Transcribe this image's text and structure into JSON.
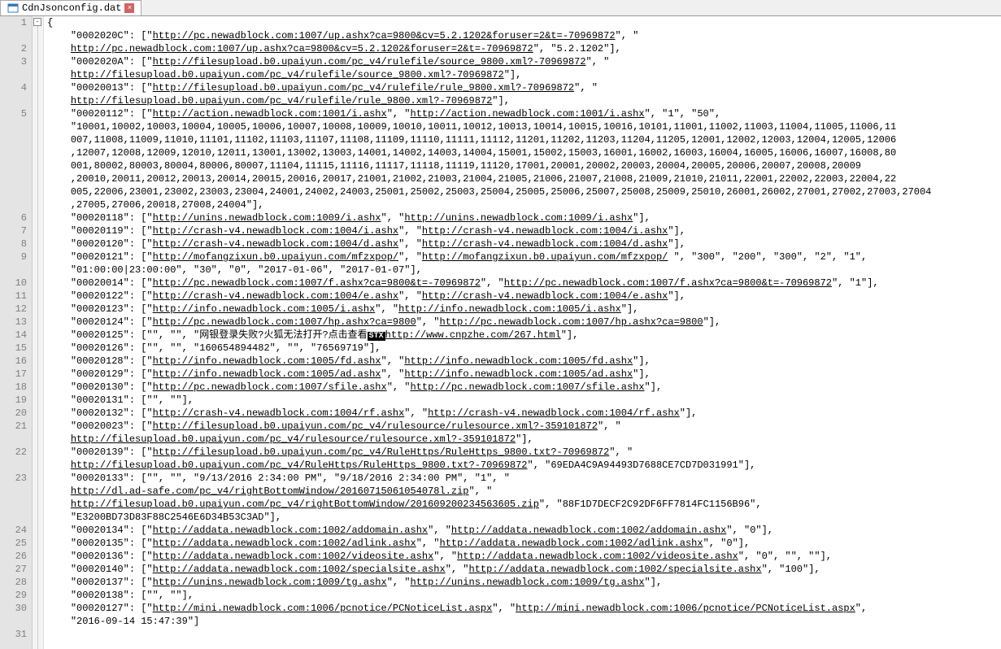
{
  "tab": {
    "filename": "CdnJsonconfig.dat",
    "close": "×"
  },
  "fold": "-",
  "lines": [
    {
      "n": 1,
      "ind": 0,
      "segs": [
        {
          "t": "txt",
          "v": "{"
        }
      ]
    },
    {
      "n": 0,
      "ind": 1,
      "segs": [
        {
          "t": "txt",
          "v": "\"0002020C\": [\""
        },
        {
          "t": "url",
          "v": "http://pc.newadblock.com:1007/up.ashx?ca=9800&cv=5.2.1202&foruser=2&t=-70969872"
        },
        {
          "t": "txt",
          "v": "\", \""
        }
      ]
    },
    {
      "n": 2,
      "ind": 1,
      "segs": [
        {
          "t": "url",
          "v": "http://pc.newadblock.com:1007/up.ashx?ca=9800&cv=5.2.1202&foruser=2&t=-70969872"
        },
        {
          "t": "txt",
          "v": "\", \"5.2.1202\"],"
        }
      ]
    },
    {
      "n": 3,
      "ind": 1,
      "segs": [
        {
          "t": "txt",
          "v": "\"0002020A\": [\""
        },
        {
          "t": "url",
          "v": "http://filesupload.b0.upaiyun.com/pc_v4/rulefile/source_9800.xml?-70969872"
        },
        {
          "t": "txt",
          "v": "\", \""
        }
      ]
    },
    {
      "n": 0,
      "ind": 1,
      "segs": [
        {
          "t": "url",
          "v": "http://filesupload.b0.upaiyun.com/pc_v4/rulefile/source_9800.xml?-70969872"
        },
        {
          "t": "txt",
          "v": "\"],"
        }
      ]
    },
    {
      "n": 4,
      "ind": 1,
      "segs": [
        {
          "t": "txt",
          "v": "\"00020013\": [\""
        },
        {
          "t": "url",
          "v": "http://filesupload.b0.upaiyun.com/pc_v4/rulefile/rule_9800.xml?-70969872"
        },
        {
          "t": "txt",
          "v": "\", \""
        }
      ]
    },
    {
      "n": 0,
      "ind": 1,
      "segs": [
        {
          "t": "url",
          "v": "http://filesupload.b0.upaiyun.com/pc_v4/rulefile/rule_9800.xml?-70969872"
        },
        {
          "t": "txt",
          "v": "\"],"
        }
      ]
    },
    {
      "n": 5,
      "ind": 1,
      "segs": [
        {
          "t": "txt",
          "v": "\"00020112\": [\""
        },
        {
          "t": "url",
          "v": "http://action.newadblock.com:1001/i.ashx"
        },
        {
          "t": "txt",
          "v": "\", \""
        },
        {
          "t": "url",
          "v": "http://action.newadblock.com:1001/i.ashx"
        },
        {
          "t": "txt",
          "v": "\", \"1\", \"50\","
        }
      ]
    },
    {
      "n": 0,
      "ind": 1,
      "segs": [
        {
          "t": "txt",
          "v": "\"10001,10002,10003,10004,10005,10006,10007,10008,10009,10010,10011,10012,10013,10014,10015,10016,10101,11001,11002,11003,11004,11005,11006,11"
        }
      ]
    },
    {
      "n": 0,
      "ind": 1,
      "segs": [
        {
          "t": "txt",
          "v": "007,11008,11009,11010,11101,11102,11103,11107,11108,11109,11110,11111,11112,11201,11202,11203,11204,11205,12001,12002,12003,12004,12005,12006"
        }
      ]
    },
    {
      "n": 0,
      "ind": 1,
      "segs": [
        {
          "t": "txt",
          "v": ",12007,12008,12009,12010,12011,13001,13002,13003,14001,14002,14003,14004,15001,15002,15003,16001,16002,16003,16004,16005,16006,16007,16008,80"
        }
      ]
    },
    {
      "n": 0,
      "ind": 1,
      "segs": [
        {
          "t": "txt",
          "v": "001,80002,80003,80004,80006,80007,11104,11115,11116,11117,11118,11119,11120,17001,20001,20002,20003,20004,20005,20006,20007,20008,20009"
        }
      ]
    },
    {
      "n": 0,
      "ind": 1,
      "segs": [
        {
          "t": "txt",
          "v": ",20010,20011,20012,20013,20014,20015,20016,20017,21001,21002,21003,21004,21005,21006,21007,21008,21009,21010,21011,22001,22002,22003,22004,22"
        }
      ]
    },
    {
      "n": 0,
      "ind": 1,
      "segs": [
        {
          "t": "txt",
          "v": "005,22006,23001,23002,23003,23004,24001,24002,24003,25001,25002,25003,25004,25005,25006,25007,25008,25009,25010,26001,26002,27001,27002,27003,27004"
        }
      ]
    },
    {
      "n": 0,
      "ind": 1,
      "segs": [
        {
          "t": "txt",
          "v": ",27005,27006,20018,27008,24004\"],"
        }
      ]
    },
    {
      "n": 6,
      "ind": 1,
      "segs": [
        {
          "t": "txt",
          "v": "\"00020118\": [\""
        },
        {
          "t": "url",
          "v": "http://unins.newadblock.com:1009/i.ashx"
        },
        {
          "t": "txt",
          "v": "\", \""
        },
        {
          "t": "url",
          "v": "http://unins.newadblock.com:1009/i.ashx"
        },
        {
          "t": "txt",
          "v": "\"],"
        }
      ]
    },
    {
      "n": 7,
      "ind": 1,
      "segs": [
        {
          "t": "txt",
          "v": "\"00020119\": [\""
        },
        {
          "t": "url",
          "v": "http://crash-v4.newadblock.com:1004/i.ashx"
        },
        {
          "t": "txt",
          "v": "\", \""
        },
        {
          "t": "url",
          "v": "http://crash-v4.newadblock.com:1004/i.ashx"
        },
        {
          "t": "txt",
          "v": "\"],"
        }
      ]
    },
    {
      "n": 8,
      "ind": 1,
      "segs": [
        {
          "t": "txt",
          "v": "\"00020120\": [\""
        },
        {
          "t": "url",
          "v": "http://crash-v4.newadblock.com:1004/d.ashx"
        },
        {
          "t": "txt",
          "v": "\", \""
        },
        {
          "t": "url",
          "v": "http://crash-v4.newadblock.com:1004/d.ashx"
        },
        {
          "t": "txt",
          "v": "\"],"
        }
      ]
    },
    {
      "n": 9,
      "ind": 1,
      "segs": [
        {
          "t": "txt",
          "v": "\"00020121\": [\""
        },
        {
          "t": "url",
          "v": "http://mofangzixun.b0.upaiyun.com/mfzxpop/"
        },
        {
          "t": "txt",
          "v": "\", \""
        },
        {
          "t": "url",
          "v": "http://mofangzixun.b0.upaiyun.com/mfzxpop/"
        },
        {
          "t": "txt",
          "v": " \", \"300\", \"200\", \"300\", \"2\", \"1\","
        }
      ]
    },
    {
      "n": 0,
      "ind": 1,
      "segs": [
        {
          "t": "txt",
          "v": "\"01:00:00|23:00:00\", \"30\", \"0\", \"2017-01-06\", \"2017-01-07\"],"
        }
      ]
    },
    {
      "n": 10,
      "ind": 1,
      "segs": [
        {
          "t": "txt",
          "v": "\"00020014\": [\""
        },
        {
          "t": "url",
          "v": "http://pc.newadblock.com:1007/f.ashx?ca=9800&t=-70969872"
        },
        {
          "t": "txt",
          "v": "\", \""
        },
        {
          "t": "url",
          "v": "http://pc.newadblock.com:1007/f.ashx?ca=9800&t=-70969872"
        },
        {
          "t": "txt",
          "v": "\", \"1\"],"
        }
      ]
    },
    {
      "n": 11,
      "ind": 1,
      "segs": [
        {
          "t": "txt",
          "v": "\"00020122\": [\""
        },
        {
          "t": "url",
          "v": "http://crash-v4.newadblock.com:1004/e.ashx"
        },
        {
          "t": "txt",
          "v": "\", \""
        },
        {
          "t": "url",
          "v": "http://crash-v4.newadblock.com:1004/e.ashx"
        },
        {
          "t": "txt",
          "v": "\"],"
        }
      ]
    },
    {
      "n": 12,
      "ind": 1,
      "segs": [
        {
          "t": "txt",
          "v": "\"00020123\": [\""
        },
        {
          "t": "url",
          "v": "http://info.newadblock.com:1005/i.ashx"
        },
        {
          "t": "txt",
          "v": "\", \""
        },
        {
          "t": "url",
          "v": "http://info.newadblock.com:1005/i.ashx"
        },
        {
          "t": "txt",
          "v": "\"],"
        }
      ]
    },
    {
      "n": 13,
      "ind": 1,
      "segs": [
        {
          "t": "txt",
          "v": "\"00020124\": [\""
        },
        {
          "t": "url",
          "v": "http://pc.newadblock.com:1007/hp.ashx?ca=9800"
        },
        {
          "t": "txt",
          "v": "\", \""
        },
        {
          "t": "url",
          "v": "http://pc.newadblock.com:1007/hp.ashx?ca=9800"
        },
        {
          "t": "txt",
          "v": "\"],"
        }
      ]
    },
    {
      "n": 14,
      "ind": 1,
      "segs": [
        {
          "t": "txt",
          "v": "\"00020125\": [\"\", \"\", \"网银登录失败?火狐无法打开?点击查看"
        },
        {
          "t": "stx",
          "v": "STX"
        },
        {
          "t": "url",
          "v": "http://www.cnpzhe.com/267.html"
        },
        {
          "t": "txt",
          "v": "\"],"
        }
      ]
    },
    {
      "n": 15,
      "ind": 1,
      "segs": [
        {
          "t": "txt",
          "v": "\"00020126\": [\"\", \"\", \"160654894482\", \"\", \"76569719\"],"
        }
      ]
    },
    {
      "n": 16,
      "ind": 1,
      "segs": [
        {
          "t": "txt",
          "v": "\"00020128\": [\""
        },
        {
          "t": "url",
          "v": "http://info.newadblock.com:1005/fd.ashx"
        },
        {
          "t": "txt",
          "v": "\", \""
        },
        {
          "t": "url",
          "v": "http://info.newadblock.com:1005/fd.ashx"
        },
        {
          "t": "txt",
          "v": "\"],"
        }
      ]
    },
    {
      "n": 17,
      "ind": 1,
      "segs": [
        {
          "t": "txt",
          "v": "\"00020129\": [\""
        },
        {
          "t": "url",
          "v": "http://info.newadblock.com:1005/ad.ashx"
        },
        {
          "t": "txt",
          "v": "\", \""
        },
        {
          "t": "url",
          "v": "http://info.newadblock.com:1005/ad.ashx"
        },
        {
          "t": "txt",
          "v": "\"],"
        }
      ]
    },
    {
      "n": 18,
      "ind": 1,
      "segs": [
        {
          "t": "txt",
          "v": "\"00020130\": [\""
        },
        {
          "t": "url",
          "v": "http://pc.newadblock.com:1007/sfile.ashx"
        },
        {
          "t": "txt",
          "v": "\", \""
        },
        {
          "t": "url",
          "v": "http://pc.newadblock.com:1007/sfile.ashx"
        },
        {
          "t": "txt",
          "v": "\"],"
        }
      ]
    },
    {
      "n": 19,
      "ind": 1,
      "segs": [
        {
          "t": "txt",
          "v": "\"00020131\": [\"\", \"\"],"
        }
      ]
    },
    {
      "n": 20,
      "ind": 1,
      "segs": [
        {
          "t": "txt",
          "v": "\"00020132\": [\""
        },
        {
          "t": "url",
          "v": "http://crash-v4.newadblock.com:1004/rf.ashx"
        },
        {
          "t": "txt",
          "v": "\", \""
        },
        {
          "t": "url",
          "v": "http://crash-v4.newadblock.com:1004/rf.ashx"
        },
        {
          "t": "txt",
          "v": "\"],"
        }
      ]
    },
    {
      "n": 21,
      "ind": 1,
      "segs": [
        {
          "t": "txt",
          "v": "\"00020023\": [\""
        },
        {
          "t": "url",
          "v": "http://filesupload.b0.upaiyun.com/pc_v4/rulesource/rulesource.xml?-359101872"
        },
        {
          "t": "txt",
          "v": "\", \""
        }
      ]
    },
    {
      "n": 0,
      "ind": 1,
      "segs": [
        {
          "t": "url",
          "v": "http://filesupload.b0.upaiyun.com/pc_v4/rulesource/rulesource.xml?-359101872"
        },
        {
          "t": "txt",
          "v": "\"],"
        }
      ]
    },
    {
      "n": 22,
      "ind": 1,
      "segs": [
        {
          "t": "txt",
          "v": "\"00020139\": [\""
        },
        {
          "t": "url",
          "v": "http://filesupload.b0.upaiyun.com/pc_v4/RuleHttps/RuleHttps_9800.txt?-70969872"
        },
        {
          "t": "txt",
          "v": "\", \""
        }
      ]
    },
    {
      "n": 0,
      "ind": 1,
      "segs": [
        {
          "t": "url",
          "v": "http://filesupload.b0.upaiyun.com/pc_v4/RuleHttps/RuleHttps_9800.txt?-70969872"
        },
        {
          "t": "txt",
          "v": "\", \"69EDA4C9A94493D7688CE7CD7D031991\"],"
        }
      ]
    },
    {
      "n": 23,
      "ind": 1,
      "segs": [
        {
          "t": "txt",
          "v": "\"00020133\": [\"\", \"\", \"9/13/2016 2:34:00 PM\", \"9/18/2016 2:34:00 PM\", \"1\", \""
        }
      ]
    },
    {
      "n": 0,
      "ind": 1,
      "segs": [
        {
          "t": "url",
          "v": "http://dl.ad-safe.com/pc_v4/rightBottomWindow/20160715061054078l.zip"
        },
        {
          "t": "txt",
          "v": "\", \""
        }
      ]
    },
    {
      "n": 0,
      "ind": 1,
      "segs": [
        {
          "t": "url",
          "v": "http://filesupload.b0.upaiyun.com/pc_v4/rightBottomWindow/201609200234563605.zip"
        },
        {
          "t": "txt",
          "v": "\", \"88F1D7DECF2C92DF6FF7814FC1156B96\","
        }
      ]
    },
    {
      "n": 0,
      "ind": 1,
      "segs": [
        {
          "t": "txt",
          "v": "\"E3200BD73D83F88C2546E6D34B53C3AD\"],"
        }
      ]
    },
    {
      "n": 24,
      "ind": 1,
      "segs": [
        {
          "t": "txt",
          "v": "\"00020134\": [\""
        },
        {
          "t": "url",
          "v": "http://addata.newadblock.com:1002/addomain.ashx"
        },
        {
          "t": "txt",
          "v": "\", \""
        },
        {
          "t": "url",
          "v": "http://addata.newadblock.com:1002/addomain.ashx"
        },
        {
          "t": "txt",
          "v": "\", \"0\"],"
        }
      ]
    },
    {
      "n": 25,
      "ind": 1,
      "segs": [
        {
          "t": "txt",
          "v": "\"00020135\": [\""
        },
        {
          "t": "url",
          "v": "http://addata.newadblock.com:1002/adlink.ashx"
        },
        {
          "t": "txt",
          "v": "\", \""
        },
        {
          "t": "url",
          "v": "http://addata.newadblock.com:1002/adlink.ashx"
        },
        {
          "t": "txt",
          "v": "\", \"0\"],"
        }
      ]
    },
    {
      "n": 26,
      "ind": 1,
      "segs": [
        {
          "t": "txt",
          "v": "\"00020136\": [\""
        },
        {
          "t": "url",
          "v": "http://addata.newadblock.com:1002/videosite.ashx"
        },
        {
          "t": "txt",
          "v": "\", \""
        },
        {
          "t": "url",
          "v": "http://addata.newadblock.com:1002/videosite.ashx"
        },
        {
          "t": "txt",
          "v": "\", \"0\", \"\", \"\"],"
        }
      ]
    },
    {
      "n": 27,
      "ind": 1,
      "segs": [
        {
          "t": "txt",
          "v": "\"00020140\": [\""
        },
        {
          "t": "url",
          "v": "http://addata.newadblock.com:1002/specialsite.ashx"
        },
        {
          "t": "txt",
          "v": "\", \""
        },
        {
          "t": "url",
          "v": "http://addata.newadblock.com:1002/specialsite.ashx"
        },
        {
          "t": "txt",
          "v": "\", \"100\"],"
        }
      ]
    },
    {
      "n": 28,
      "ind": 1,
      "segs": [
        {
          "t": "txt",
          "v": "\"00020137\": [\""
        },
        {
          "t": "url",
          "v": "http://unins.newadblock.com:1009/tg.ashx"
        },
        {
          "t": "txt",
          "v": "\", \""
        },
        {
          "t": "url",
          "v": "http://unins.newadblock.com:1009/tg.ashx"
        },
        {
          "t": "txt",
          "v": "\"],"
        }
      ]
    },
    {
      "n": 29,
      "ind": 1,
      "segs": [
        {
          "t": "txt",
          "v": "\"00020138\": [\"\", \"\"],"
        }
      ]
    },
    {
      "n": 30,
      "ind": 1,
      "segs": [
        {
          "t": "txt",
          "v": "\"00020127\": [\""
        },
        {
          "t": "url",
          "v": "http://mini.newadblock.com:1006/pcnotice/PCNoticeList.aspx"
        },
        {
          "t": "txt",
          "v": "\", \""
        },
        {
          "t": "url",
          "v": "http://mini.newadblock.com:1006/pcnotice/PCNoticeList.aspx"
        },
        {
          "t": "txt",
          "v": "\","
        }
      ]
    },
    {
      "n": 0,
      "ind": 1,
      "segs": [
        {
          "t": "txt",
          "v": "\"2016-09-14 15:47:39\"]"
        }
      ]
    },
    {
      "n": 31,
      "ind": 0,
      "segs": [
        {
          "t": "txt",
          "v": ""
        }
      ]
    }
  ]
}
